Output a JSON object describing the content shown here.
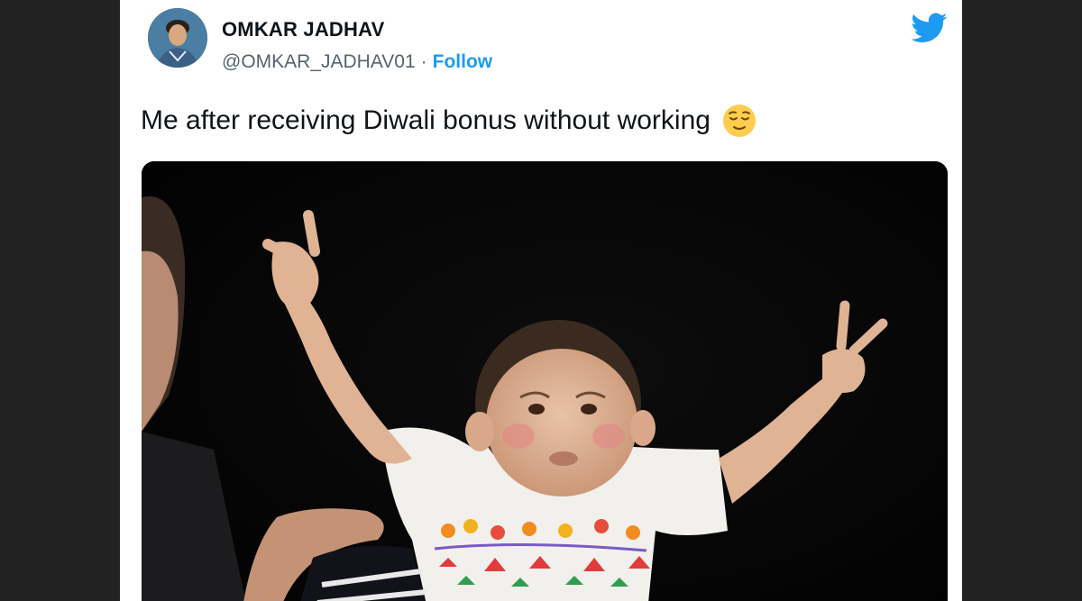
{
  "tweet": {
    "display_name": "OMKAR JADHAV",
    "handle": "@OMKAR_JADHAV01",
    "separator": "·",
    "follow_label": "Follow",
    "text": "Me after receiving Diwali bonus without working",
    "emoji_icon": "relieved-face-emoji",
    "platform_icon": "twitter-bird-icon"
  },
  "colors": {
    "brand_blue": "#1d9bf0",
    "text_primary": "#0f1419",
    "text_secondary": "#536471"
  }
}
